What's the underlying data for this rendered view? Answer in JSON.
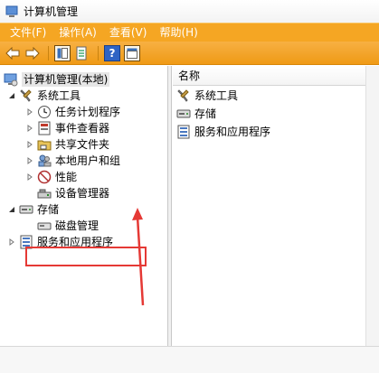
{
  "window": {
    "title": "计算机管理"
  },
  "menu": {
    "file": "文件(F)",
    "action": "操作(A)",
    "view": "查看(V)",
    "help": "帮助(H)"
  },
  "tree": {
    "root": "计算机管理(本地)",
    "system_tools": "系统工具",
    "task_scheduler": "任务计划程序",
    "event_viewer": "事件查看器",
    "shared_folders": "共享文件夹",
    "local_users": "本地用户和组",
    "performance": "性能",
    "device_manager": "设备管理器",
    "storage": "存储",
    "disk_management": "磁盘管理",
    "services": "服务和应用程序"
  },
  "list": {
    "column_name": "名称",
    "items": [
      "系统工具",
      "存储",
      "服务和应用程序"
    ]
  },
  "colors": {
    "menubar": "#f5a623",
    "annotation": "#e53935"
  }
}
